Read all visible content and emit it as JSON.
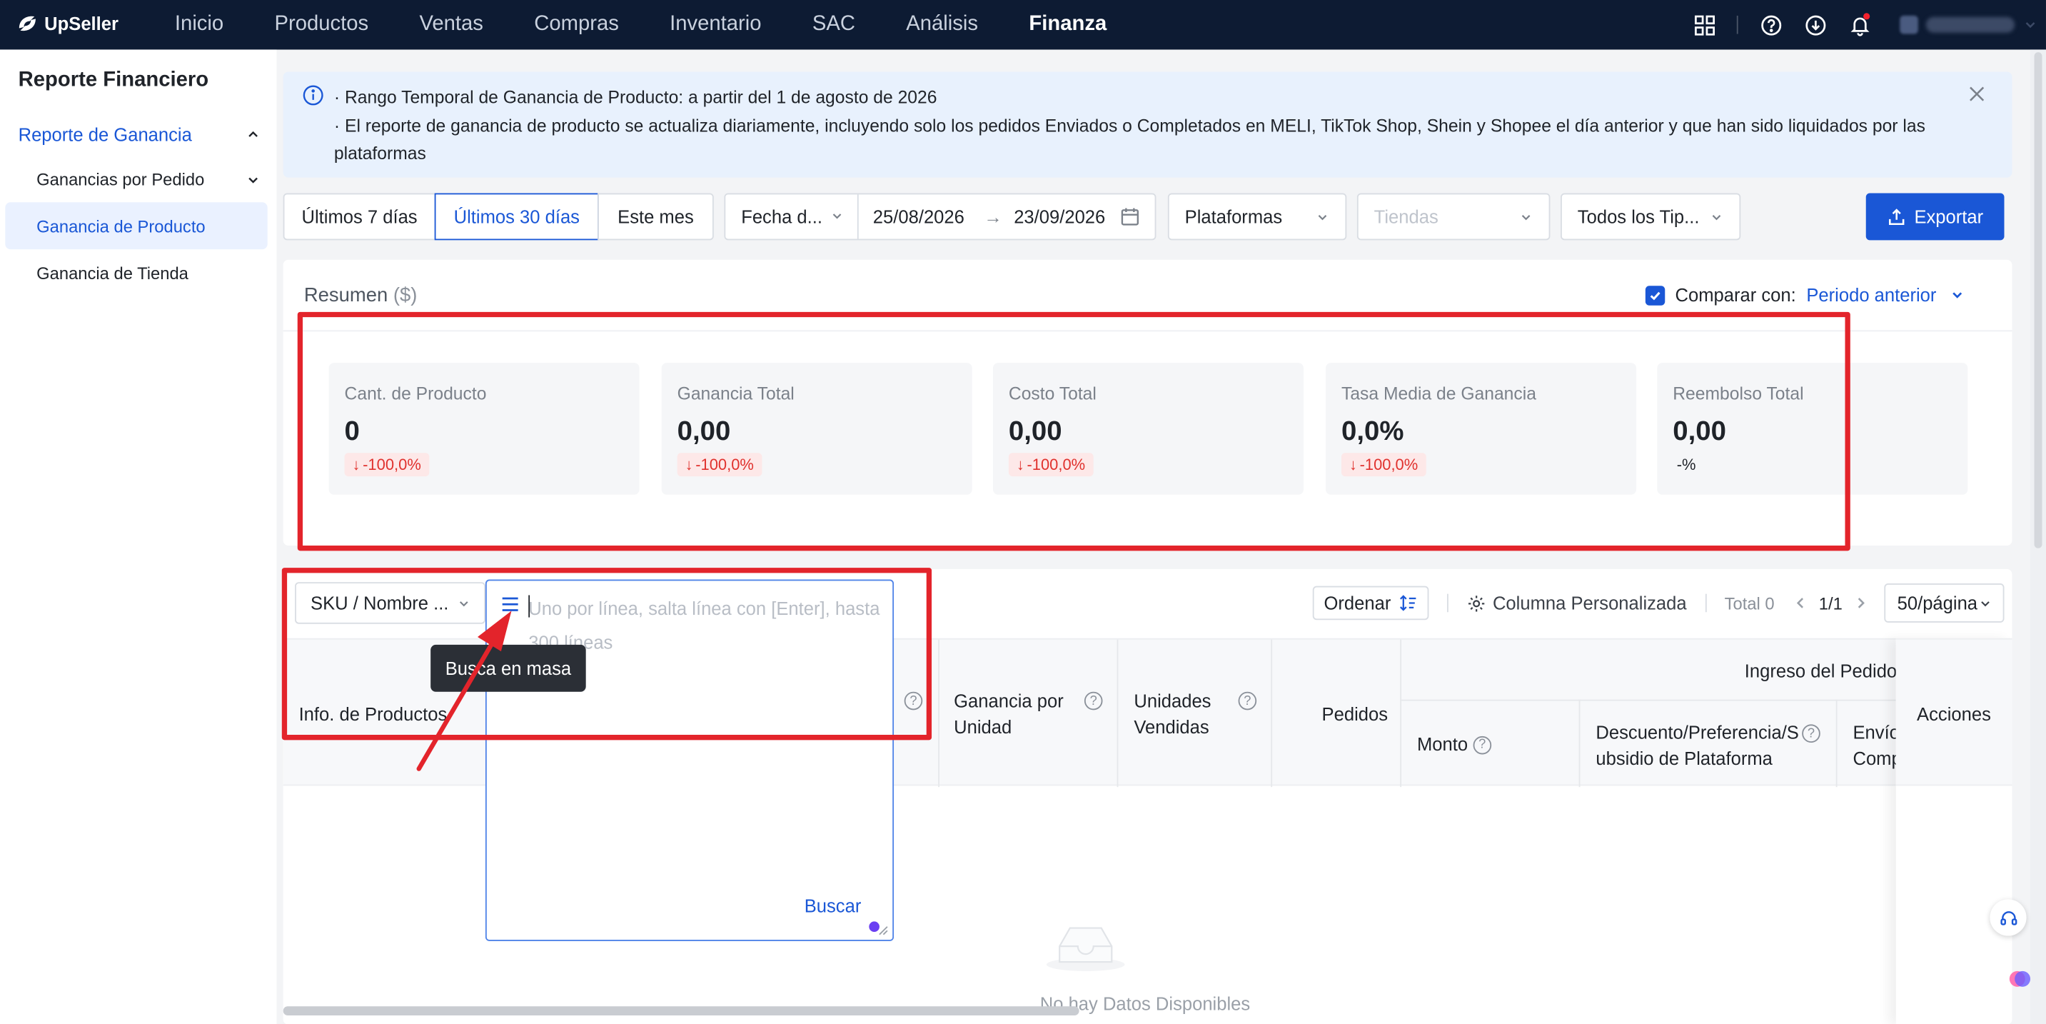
{
  "app": {
    "brand": "UpSeller"
  },
  "nav": {
    "items": [
      "Inicio",
      "Productos",
      "Ventas",
      "Compras",
      "Inventario",
      "SAC",
      "Análisis",
      "Finanza"
    ],
    "active": "Finanza"
  },
  "sidebar": {
    "title": "Reporte Financiero",
    "group": "Reporte de Ganancia",
    "sub": "Ganancias por Pedido",
    "items": [
      "Ganancia de Producto",
      "Ganancia de Tienda"
    ]
  },
  "banner": {
    "line1": "· Rango Temporal de Ganancia de Producto: a partir del 1 de agosto de 2026",
    "line2": "· El reporte de ganancia de producto se actualiza diariamente, incluyendo solo los pedidos Enviados o Completados en MELI, TikTok Shop, Shein y Shopee el día anterior y que han sido liquidados por las plataformas"
  },
  "filters": {
    "ranges": [
      "Últimos 7 días",
      "Últimos 30 días",
      "Este mes"
    ],
    "active_range": "Últimos 30 días",
    "date_type": "Fecha d...",
    "date_from": "25/08/2026",
    "date_to": "23/09/2026",
    "platforms": "Plataformas",
    "stores_placeholder": "Tiendas",
    "types": "Todos los Tip...",
    "export": "Exportar"
  },
  "summary": {
    "title": "Resumen",
    "unit": "($)",
    "compare_label": "Comparar con:",
    "compare_value": "Periodo anterior",
    "compare_checked": true,
    "stats": [
      {
        "label": "Cant. de Producto",
        "value": "0",
        "change": "-100,0%",
        "trend": "down"
      },
      {
        "label": "Ganancia Total",
        "value": "0,00",
        "change": "-100,0%",
        "trend": "down"
      },
      {
        "label": "Costo Total",
        "value": "0,00",
        "change": "-100,0%",
        "trend": "down"
      },
      {
        "label": "Tasa Media de Ganancia",
        "value": "0,0%",
        "change": "-100,0%",
        "trend": "down"
      },
      {
        "label": "Reembolso Total",
        "value": "0,00",
        "change": "-%",
        "trend": "none"
      }
    ]
  },
  "table": {
    "search_field": "SKU / Nombre ...",
    "search_placeholder": "Uno por línea, salta línea con [Enter], hasta 300 líneas",
    "search_button": "Buscar",
    "bulk_tooltip": "Busca en masa",
    "sort_label": "Ordenar",
    "custom_columns": "Columna Personalizada",
    "total": "Total 0",
    "page": "1/1",
    "per_page": "50/página",
    "headers": {
      "info": "Info. de Productos",
      "profit_unit": "Ganancia por Unidad",
      "units_sold": "Unidades Vendidas",
      "orders": "Pedidos",
      "order_income": "Ingreso del Pedido",
      "amount": "Monto",
      "discount": "Descuento/Preferencia/Subsidio de Plataforma",
      "shipping": "Envío Comp...",
      "actions": "Acciones"
    },
    "empty_text": "No hay Datos Disponibles"
  },
  "colors": {
    "nav_bg": "#0d1b33",
    "accent": "#1a57d6",
    "highlight": "#e3242b",
    "negative": "#e0312d"
  }
}
